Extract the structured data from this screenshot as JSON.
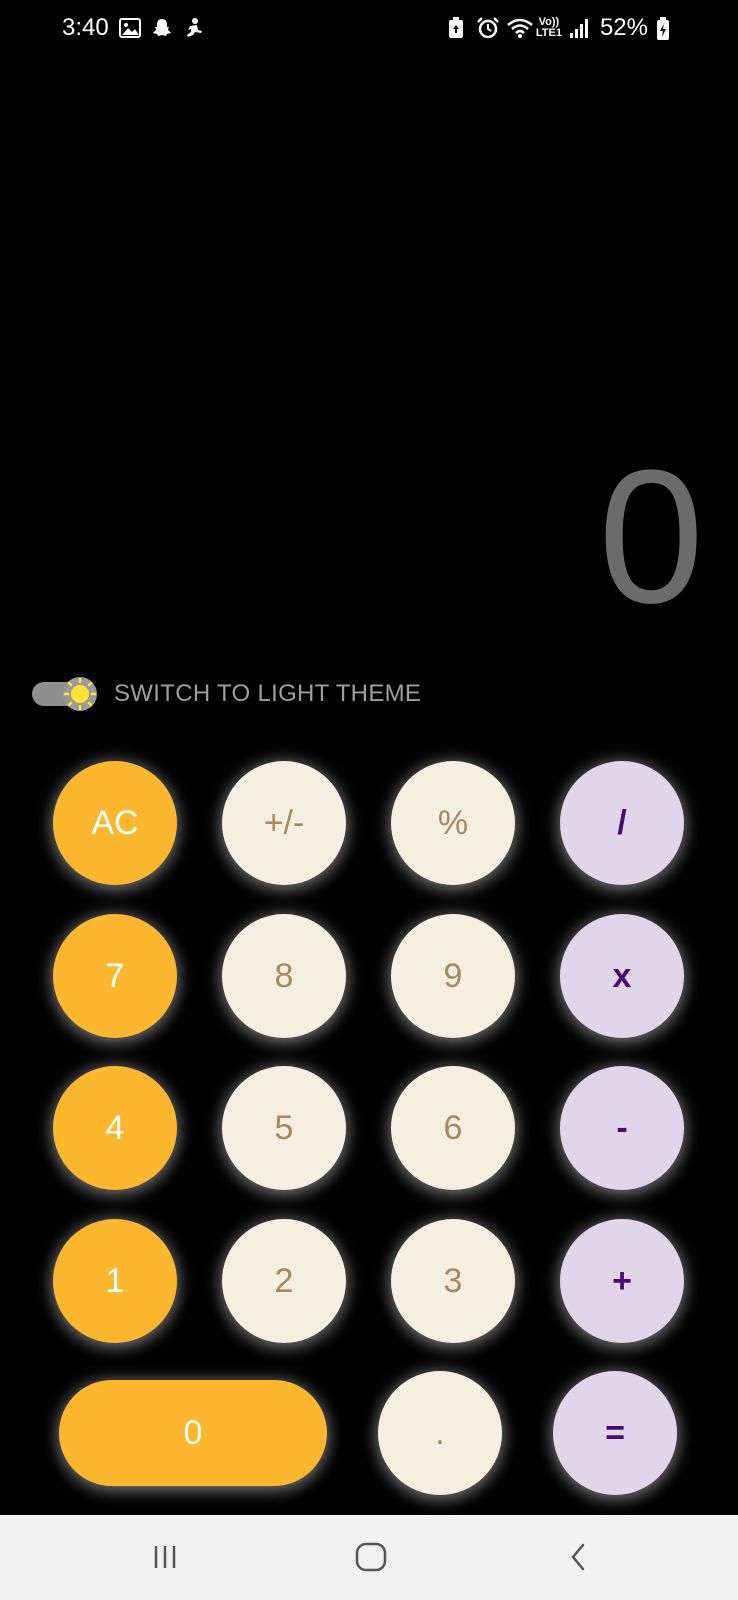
{
  "status_bar": {
    "time": "3:40",
    "left_icons": [
      "gallery-icon",
      "snapchat-icon",
      "fitness-icon"
    ],
    "right_icons": [
      "battery-saver-icon",
      "alarm-icon",
      "wifi-icon",
      "volte-lte-icon",
      "signal-icon"
    ],
    "volte_label": "Vo))",
    "lte_label": "LTE1",
    "battery": "52%"
  },
  "display": {
    "value": "0"
  },
  "theme_switch": {
    "label": "SWITCH TO LIGHT THEME",
    "enabled": true,
    "icon": "sun-icon"
  },
  "keypad": {
    "row1": [
      "AC",
      "+/-",
      "%",
      "/"
    ],
    "row2": [
      "7",
      "8",
      "9",
      "x"
    ],
    "row3": [
      "4",
      "5",
      "6",
      "-"
    ],
    "row4": [
      "1",
      "2",
      "3",
      "+"
    ],
    "row5": [
      "0",
      ".",
      "="
    ]
  },
  "colors": {
    "orange": "#fcb72e",
    "cream": "#f5efe2",
    "lilac": "#e1d5ea",
    "operator_text": "#4a0a6e",
    "digit_text": "#a8895c",
    "display_text": "#6b6b6b"
  },
  "nav_bar": {
    "buttons": [
      "recents-icon",
      "home-icon",
      "back-icon"
    ]
  }
}
